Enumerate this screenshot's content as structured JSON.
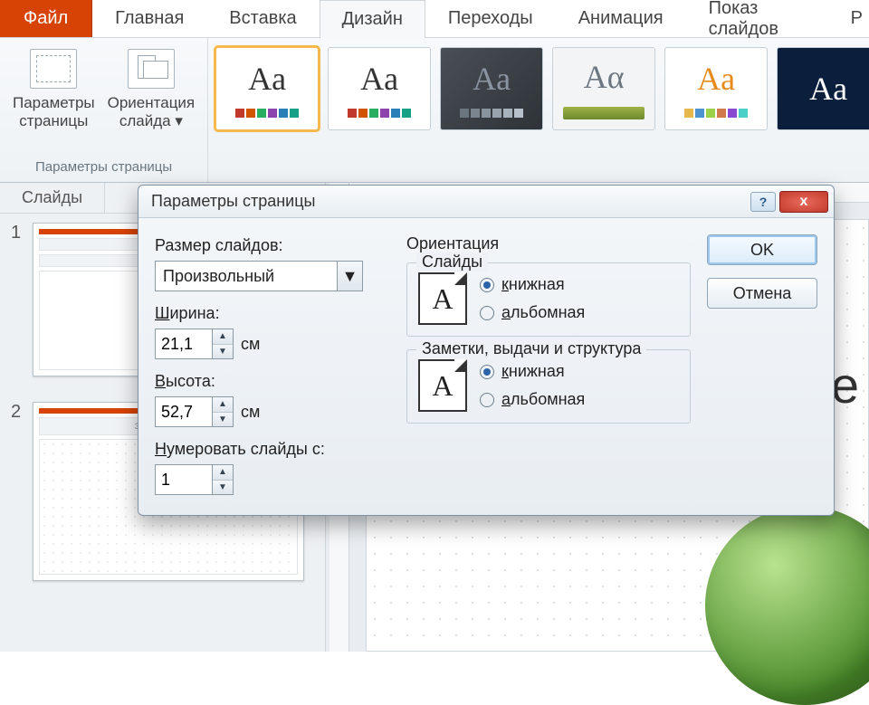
{
  "tabs": {
    "file": "Файл",
    "home": "Главная",
    "insert": "Вставка",
    "design": "Дизайн",
    "transitions": "Переходы",
    "animation": "Анимация",
    "slideshow": "Показ слайдов",
    "partial": "Р"
  },
  "ribbon": {
    "page_setup_btn": "Параметры\nстраницы",
    "orientation_btn": "Ориентация\nслайда",
    "dropdown_marker": "▾",
    "group_label": "Параметры страницы",
    "theme_sample": "Aa",
    "theme_sample_alt": "Aα"
  },
  "sidepane": {
    "tab_slides": "Слайды",
    "thumb1_num": "1",
    "thumb2_num": "2",
    "thumb2_title": "Заголовок слайда"
  },
  "canvas": {
    "text_fragment": "Те"
  },
  "dialog": {
    "title": "Параметры страницы",
    "help": "?",
    "close": "x",
    "size_label": "Размер слайдов:",
    "size_value": "Произвольный",
    "width_label_pre": "Ш",
    "width_label_rest": "ирина:",
    "width_value": "21,1",
    "height_label_pre": "В",
    "height_label_rest": "ысота:",
    "height_value": "52,7",
    "unit": "см",
    "number_label_pre": "Н",
    "number_label_rest": "умеровать слайды с:",
    "number_value": "1",
    "orientation_title": "Ориентация",
    "group_slides": "Слайды",
    "group_notes": "Заметки, выдачи и структура",
    "portrait_pre": "к",
    "portrait_rest": "нижная",
    "landscape_pre": "а",
    "landscape_rest": "льбомная",
    "orient_glyph": "A",
    "ok": "OK",
    "cancel": "Отмена",
    "spin_up": "▲",
    "spin_down": "▼",
    "combo_arrow": "▼"
  }
}
